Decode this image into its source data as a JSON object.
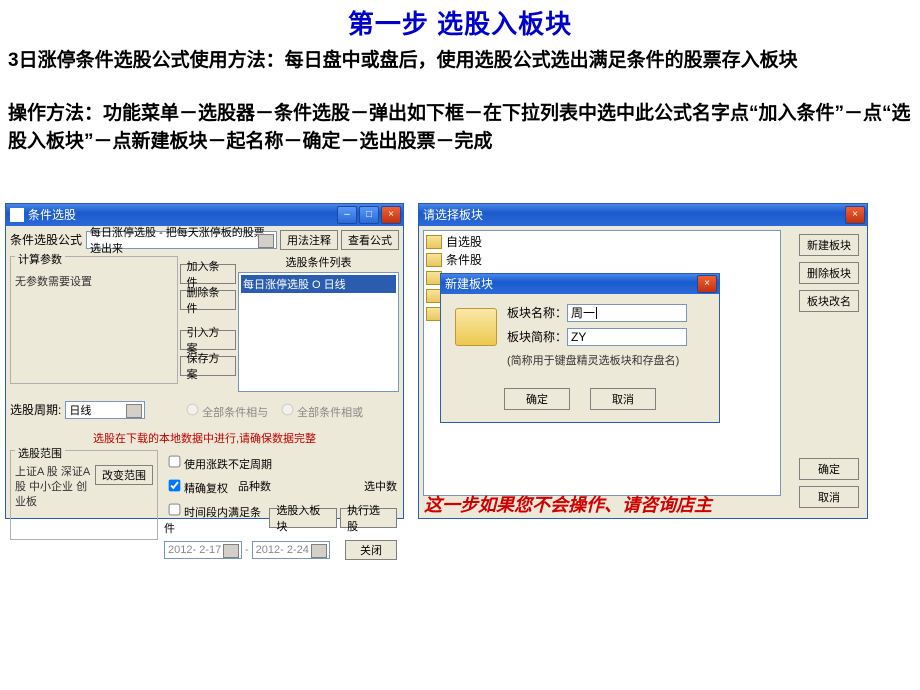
{
  "page": {
    "title": "第一步 选股入板块",
    "desc1": "3日涨停条件选股公式使用方法：每日盘中或盘后，使用选股公式选出满足条件的股票存入板块",
    "desc2": "操作方法：功能菜单－选股器－条件选股－弹出如下框－在下拉列表中选中此公式名字点“加入条件”－点“选股入板块”－点新建板块－起名称－确定－选出股票－完成",
    "annotation": "这一步如果您不会操作、请咨询店主"
  },
  "left": {
    "title": "条件选股",
    "formula_label": "条件选股公式",
    "formula_value": "每日涨停选股 - 把每天涨停板的股票选出来",
    "btn_usage": "用法注释",
    "btn_view": "查看公式",
    "params_title": "计算参数",
    "params_text": "无参数需要设置",
    "list_header": "选股条件列表",
    "list_item": "每日涨停选股 O 日线",
    "btn_add": "加入条件",
    "btn_del": "删除条件",
    "btn_import": "引入方案",
    "btn_save": "保存方案",
    "cycle_label": "选股周期:",
    "cycle_value": "日线",
    "radio1": "全部条件相与",
    "radio2": "全部条件相或",
    "warning": "选股在下载的本地数据中进行,请确保数据完整",
    "scope_title": "选股范围",
    "scope_text": "上证A 股 深证A 股 中小企业 创业板",
    "btn_scope": "改变范围",
    "chk_cycle": "使用涨跌不定周期",
    "chk_fuquan": "精确复权",
    "chk_time": "时间段内满足条件",
    "txt_pinzhong": "品种数",
    "txt_sel": "选中数",
    "btn_run": "执行选股",
    "btn_block": "选股入板块",
    "btn_close": "关闭",
    "date1": "2012- 2-17",
    "date2": "2012- 2-24"
  },
  "right": {
    "title": "请选择板块",
    "tree": [
      "自选股",
      "条件股",
      "",
      "",
      ""
    ],
    "btn_new": "新建板块",
    "btn_del": "删除板块",
    "btn_ren": "板块改名",
    "btn_ok": "确定",
    "btn_cancel": "取消"
  },
  "modal": {
    "title": "新建板块",
    "name_label": "板块名称：",
    "name_value": "周一",
    "short_label": "板块简称：",
    "short_value": "ZY",
    "hint": "(简称用于键盘精灵选板块和存盘名)",
    "ok": "确定",
    "cancel": "取消"
  }
}
